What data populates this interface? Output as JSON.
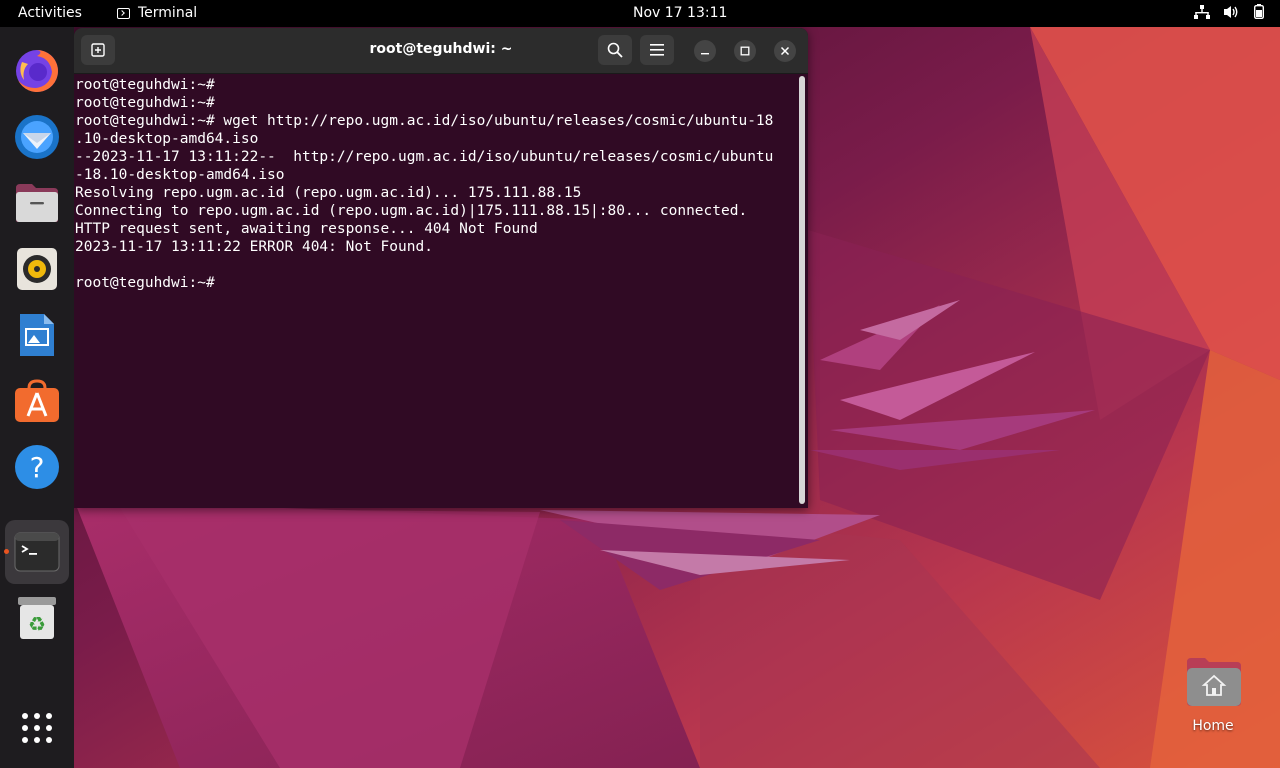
{
  "topbar": {
    "activities": "Activities",
    "app_name": "Terminal",
    "clock": "Nov 17  13:11",
    "tray_icons": [
      "network-icon",
      "volume-icon",
      "battery-icon"
    ]
  },
  "dock": {
    "apps": [
      {
        "name": "firefox-icon",
        "running": false
      },
      {
        "name": "thunderbird-icon",
        "running": false
      },
      {
        "name": "files-icon",
        "running": false
      },
      {
        "name": "rhythmbox-icon",
        "running": false
      },
      {
        "name": "libreoffice-writer-icon",
        "running": false
      },
      {
        "name": "app-center-icon",
        "running": false
      },
      {
        "name": "help-icon",
        "running": false
      },
      {
        "name": "terminal-icon",
        "running": true
      },
      {
        "name": "trash-icon",
        "running": false
      }
    ],
    "show_apps": "show-applications-icon"
  },
  "terminal": {
    "title": "root@teguhdwi: ~",
    "lines": [
      "root@teguhdwi:~#",
      "root@teguhdwi:~#",
      "root@teguhdwi:~# wget http://repo.ugm.ac.id/iso/ubuntu/releases/cosmic/ubuntu-18",
      ".10-desktop-amd64.iso",
      "--2023-11-17 13:11:22--  http://repo.ugm.ac.id/iso/ubuntu/releases/cosmic/ubuntu",
      "-18.10-desktop-amd64.iso",
      "Resolving repo.ugm.ac.id (repo.ugm.ac.id)... 175.111.88.15",
      "Connecting to repo.ugm.ac.id (repo.ugm.ac.id)|175.111.88.15|:80... connected.",
      "HTTP request sent, awaiting response... 404 Not Found",
      "2023-11-17 13:11:22 ERROR 404: Not Found.",
      "",
      "root@teguhdwi:~#"
    ]
  },
  "desktop": {
    "home_label": "Home"
  },
  "colors": {
    "terminal_bg": "#300a24",
    "accent": "#e95420",
    "header_bg": "#2c2c2c"
  }
}
